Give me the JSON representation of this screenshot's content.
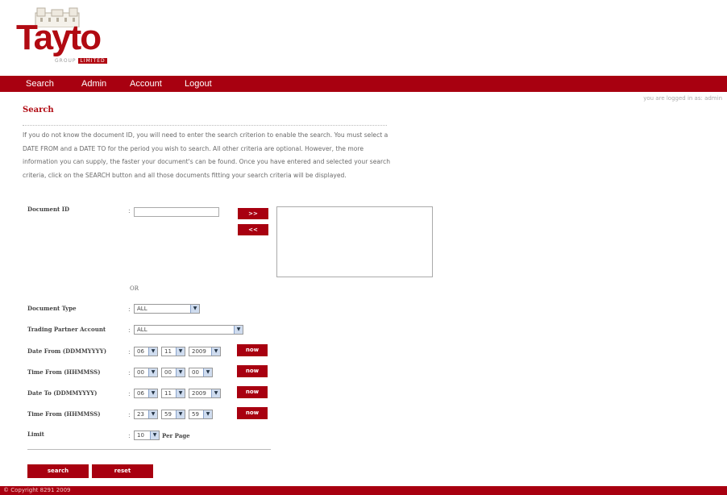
{
  "brand": {
    "name": "Tayto",
    "sub_group": "GROUP",
    "sub_limited": "LIMITED"
  },
  "nav": {
    "items": [
      {
        "label": "Search"
      },
      {
        "label": "Admin"
      },
      {
        "label": "Account"
      },
      {
        "label": "Logout"
      }
    ]
  },
  "status": {
    "logged_in": "you are logged in as: admin"
  },
  "page": {
    "title": "Search",
    "intro": "If you do not know the document ID, you will need to enter the search criterion to enable the search. You must select a DATE FROM and a DATE TO for the period you wish to search. All other criteria are optional. However, the more information you can supply, the faster your document's can be found. Once you have entered and selected your search criteria, click on the SEARCH button and all those documents fitting your search criteria will be displayed."
  },
  "form": {
    "colon": ":",
    "document_id": {
      "label": "Document ID",
      "value": "",
      "add_label": ">>",
      "remove_label": "<<"
    },
    "or_label": "OR",
    "document_type": {
      "label": "Document Type",
      "value": "ALL"
    },
    "trading_partner": {
      "label": "Trading Partner Account",
      "value": "ALL"
    },
    "date_from": {
      "label": "Date From (DDMMYYYY)",
      "day": "06",
      "month": "11",
      "year": "2009"
    },
    "time_from": {
      "label": "Time From (HHMMSS)",
      "hh": "00",
      "mm": "00",
      "ss": "00"
    },
    "date_to": {
      "label": "Date To (DDMMYYYY)",
      "day": "06",
      "month": "11",
      "year": "2009"
    },
    "time_to": {
      "label": "Time From (HHMMSS)",
      "hh": "23",
      "mm": "59",
      "ss": "59"
    },
    "now_label": "now",
    "limit": {
      "label": "Limit",
      "value": "10",
      "suffix": "Per Page"
    },
    "search_label": "search",
    "reset_label": "reset"
  },
  "footer": {
    "text": "© Copyright 8291 2009"
  },
  "colors": {
    "brand_red": "#a80010",
    "select_arrow": "#cfdcef"
  }
}
